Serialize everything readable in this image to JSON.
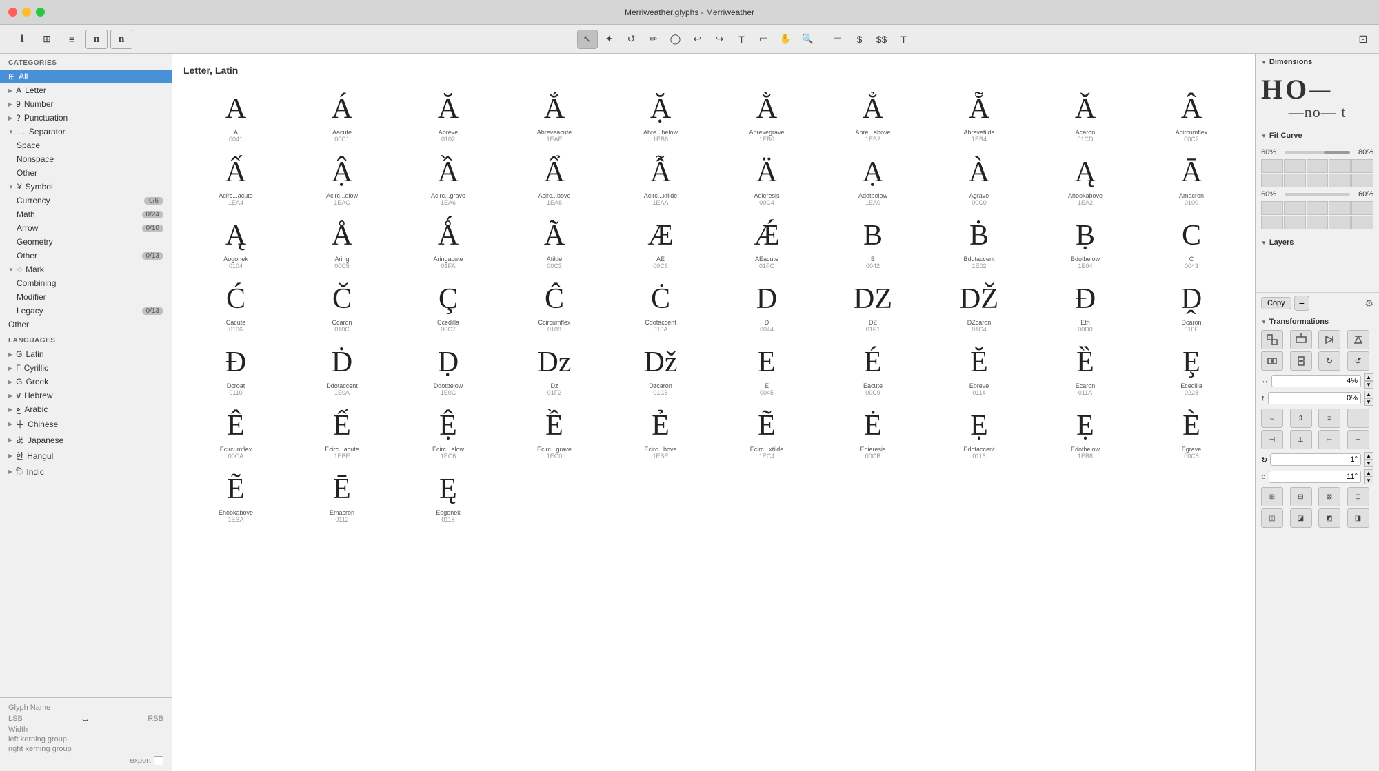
{
  "titlebar": {
    "title": "Merriweather.glyphs - Merriweather"
  },
  "toolbar": {
    "tools": [
      "↖",
      "✦",
      "↺",
      "✏",
      "◯",
      "↩",
      "↪",
      "T",
      "▭",
      "✋",
      "🔍",
      "▭",
      "$",
      "$$",
      "T"
    ]
  },
  "sidebar": {
    "categories_label": "CATEGORIES",
    "languages_label": "LANGUAGES",
    "categories": [
      {
        "id": "all",
        "label": "All",
        "icon": "⊞",
        "active": true,
        "indent": 0
      },
      {
        "id": "letter",
        "label": "Letter",
        "icon": "A",
        "active": false,
        "indent": 0,
        "chevron": "▶"
      },
      {
        "id": "number",
        "label": "Number",
        "icon": "9",
        "active": false,
        "indent": 0,
        "chevron": "▶"
      },
      {
        "id": "punctuation",
        "label": "Punctuation",
        "icon": "?",
        "active": false,
        "indent": 0,
        "chevron": "▶"
      },
      {
        "id": "separator",
        "label": "Separator",
        "icon": "…",
        "active": false,
        "indent": 0,
        "chevron": "▼"
      },
      {
        "id": "space",
        "label": "Space",
        "active": false,
        "indent": 1
      },
      {
        "id": "nonspace",
        "label": "Nonspace",
        "active": false,
        "indent": 1
      },
      {
        "id": "other-sep",
        "label": "Other",
        "active": false,
        "indent": 1
      },
      {
        "id": "symbol",
        "label": "Symbol",
        "icon": "¥",
        "active": false,
        "indent": 0,
        "chevron": "▼"
      },
      {
        "id": "currency",
        "label": "Currency",
        "active": false,
        "indent": 1,
        "badge": "0/6"
      },
      {
        "id": "math",
        "label": "Math",
        "active": false,
        "indent": 1,
        "badge": "0/24"
      },
      {
        "id": "arrow",
        "label": "Arrow",
        "active": false,
        "indent": 1,
        "badge": "0/10"
      },
      {
        "id": "geometry",
        "label": "Geometry",
        "active": false,
        "indent": 1
      },
      {
        "id": "other-sym",
        "label": "Other",
        "active": false,
        "indent": 1,
        "badge": "0/13"
      },
      {
        "id": "mark",
        "label": "Mark",
        "icon": "◌",
        "active": false,
        "indent": 0,
        "chevron": "▼"
      },
      {
        "id": "combining",
        "label": "Combining",
        "active": false,
        "indent": 1
      },
      {
        "id": "modifier",
        "label": "Modifier",
        "active": false,
        "indent": 1
      },
      {
        "id": "legacy",
        "label": "Legacy",
        "active": false,
        "indent": 1,
        "badge": "0/13"
      },
      {
        "id": "other",
        "label": "Other",
        "active": false,
        "indent": 0
      }
    ],
    "languages": [
      {
        "id": "latin",
        "label": "Latin",
        "icon": "G",
        "chevron": "▶"
      },
      {
        "id": "cyrillic",
        "label": "Cyrillic",
        "icon": "Г",
        "chevron": "▶"
      },
      {
        "id": "greek",
        "label": "Greek",
        "icon": "G",
        "chevron": "▶"
      },
      {
        "id": "hebrew",
        "label": "Hebrew",
        "icon": "ע",
        "chevron": "▶"
      },
      {
        "id": "arabic",
        "label": "Arabic",
        "icon": "ع",
        "chevron": "▶"
      },
      {
        "id": "chinese",
        "label": "Chinese",
        "icon": "中",
        "chevron": "▶"
      },
      {
        "id": "japanese",
        "label": "Japanese",
        "icon": "あ",
        "chevron": "▶"
      },
      {
        "id": "hangul",
        "label": "Hangul",
        "icon": "한",
        "chevron": "▶"
      },
      {
        "id": "indic",
        "label": "Indic",
        "icon": "ि",
        "chevron": "▶"
      }
    ],
    "footer": {
      "glyph_name_label": "Glyph Name",
      "lsb_label": "LSB",
      "rsb_label": "RSB",
      "width_label": "Width",
      "left_kerning": "left kerning group",
      "right_kerning": "right kerning group",
      "export_label": "export"
    }
  },
  "glyph_area": {
    "section_title": "Letter, Latin",
    "glyphs": [
      {
        "char": "A",
        "name": "A",
        "code": "0041"
      },
      {
        "char": "Á",
        "name": "Aacute",
        "code": "00C1"
      },
      {
        "char": "Ă",
        "name": "Abreve",
        "code": "0102"
      },
      {
        "char": "Ắ",
        "name": "Abreveacute",
        "code": "1EAE"
      },
      {
        "char": "Ặ",
        "name": "Abre...below",
        "code": "1EB6"
      },
      {
        "char": "Ằ",
        "name": "Abrevegrave",
        "code": "1EB0"
      },
      {
        "char": "Ẳ",
        "name": "Abre...above",
        "code": "1EB2"
      },
      {
        "char": "Ẵ",
        "name": "Abrevetilde",
        "code": "1EB4"
      },
      {
        "char": "Ǎ",
        "name": "Acaron",
        "code": "01CD"
      },
      {
        "char": "Â",
        "name": "Acircumflex",
        "code": "00C2"
      },
      {
        "char": "Ấ",
        "name": "Acirc...acute",
        "code": "1EA4"
      },
      {
        "char": "Ậ",
        "name": "Acirc...elow",
        "code": "1EAC"
      },
      {
        "char": "Ầ",
        "name": "Acirc...grave",
        "code": "1EA6"
      },
      {
        "char": "Ẩ",
        "name": "Acirc...bove",
        "code": "1EA8"
      },
      {
        "char": "Ẫ",
        "name": "Acirc...xtilde",
        "code": "1EAA"
      },
      {
        "char": "Ä",
        "name": "Adieresis",
        "code": "00C4"
      },
      {
        "char": "Ạ",
        "name": "Adotbelow",
        "code": "1EA0"
      },
      {
        "char": "À",
        "name": "Agrave",
        "code": "00C0"
      },
      {
        "char": "Ą",
        "name": "Ahookabove",
        "code": "1EA2"
      },
      {
        "char": "Ā",
        "name": "Amacron",
        "code": "0100"
      },
      {
        "char": "Ą",
        "name": "Aogonek",
        "code": "0104"
      },
      {
        "char": "Å",
        "name": "Aring",
        "code": "00C5"
      },
      {
        "char": "Ǻ",
        "name": "Aringacute",
        "code": "01FA"
      },
      {
        "char": "Ã",
        "name": "Atilde",
        "code": "00C3"
      },
      {
        "char": "Æ",
        "name": "AE",
        "code": "00C6"
      },
      {
        "char": "Ǽ",
        "name": "AEacute",
        "code": "01FC"
      },
      {
        "char": "B",
        "name": "B",
        "code": "0042"
      },
      {
        "char": "Ḃ",
        "name": "Bdotaccent",
        "code": "1E02"
      },
      {
        "char": "Ḅ",
        "name": "Bdotbelow",
        "code": "1E04"
      },
      {
        "char": "C",
        "name": "C",
        "code": "0043"
      },
      {
        "char": "Ć",
        "name": "Cacute",
        "code": "0106"
      },
      {
        "char": "Č",
        "name": "Ccaron",
        "code": "010C"
      },
      {
        "char": "Ç",
        "name": "Ccedilla",
        "code": "00C7"
      },
      {
        "char": "Ĉ",
        "name": "Ccircumflex",
        "code": "0108"
      },
      {
        "char": "Ċ",
        "name": "Cdotaccent",
        "code": "010A"
      },
      {
        "char": "D",
        "name": "D",
        "code": "0044"
      },
      {
        "char": "DZ",
        "name": "DZ",
        "code": "01F1"
      },
      {
        "char": "DŽ",
        "name": "DZcaron",
        "code": "01C4"
      },
      {
        "char": "Ð",
        "name": "Eth",
        "code": "00D0"
      },
      {
        "char": "Ḓ",
        "name": "Dcaron",
        "code": "010E"
      },
      {
        "char": "Đ",
        "name": "Dcroat",
        "code": "0110"
      },
      {
        "char": "Ḋ",
        "name": "Ddotaccent",
        "code": "1E0A"
      },
      {
        "char": "Ḍ",
        "name": "Ddotbelow",
        "code": "1E0C"
      },
      {
        "char": "Dz",
        "name": "Dz",
        "code": "01F2"
      },
      {
        "char": "Dž",
        "name": "Dzcaron",
        "code": "01C5"
      },
      {
        "char": "E",
        "name": "E",
        "code": "0045"
      },
      {
        "char": "É",
        "name": "Eacute",
        "code": "00C9"
      },
      {
        "char": "Ĕ",
        "name": "Ebreve",
        "code": "0114"
      },
      {
        "char": "Ȅ",
        "name": "Ecaron",
        "code": "011A"
      },
      {
        "char": "Ȩ",
        "name": "Ecedilla",
        "code": "0228"
      },
      {
        "char": "Ê",
        "name": "Ecircumflex",
        "code": "00CA"
      },
      {
        "char": "Ế",
        "name": "Ecirc...acute",
        "code": "1EBE"
      },
      {
        "char": "Ệ",
        "name": "Ecirc...elow",
        "code": "1EC6"
      },
      {
        "char": "Ề",
        "name": "Ecirc...grave",
        "code": "1EC0"
      },
      {
        "char": "Ẻ",
        "name": "Ecirc...bove",
        "code": "1EBE"
      },
      {
        "char": "Ẽ",
        "name": "Ecirc...xtilde",
        "code": "1EC4"
      },
      {
        "char": "Ė",
        "name": "Edieresis",
        "code": "00CB"
      },
      {
        "char": "Ẹ",
        "name": "Edotaccent",
        "code": "0116"
      },
      {
        "char": "Ẹ",
        "name": "Edotbelow",
        "code": "1EB8"
      },
      {
        "char": "È",
        "name": "Egrave",
        "code": "00C8"
      },
      {
        "char": "Ẽ",
        "name": "Ehookabove",
        "code": "1EBA"
      },
      {
        "char": "Ē",
        "name": "Emacron",
        "code": "0112"
      },
      {
        "char": "Ę",
        "name": "Eogonek",
        "code": "0118"
      }
    ]
  },
  "right_panel": {
    "dimensions_label": "Dimensions",
    "preview_large": "HO—",
    "preview_small": "no— t",
    "fit_curve_label": "Fit Curve",
    "fit_60_label": "60%",
    "fit_80_label": "80%",
    "fit_80_value": "80%",
    "fit_60_value": "60%",
    "layers_label": "Layers",
    "copy_label": "Copy",
    "transformations_label": "Transformations",
    "transform_values": {
      "scale_x": "4%",
      "scale_y": "0%",
      "rotate": "1°",
      "skew": "11°"
    }
  }
}
